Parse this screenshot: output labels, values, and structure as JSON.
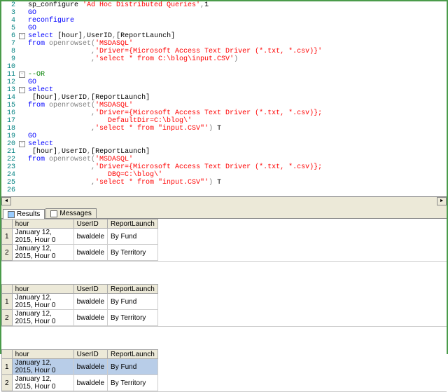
{
  "code_lines": [
    {
      "n": 2,
      "html": "<span class='kw-black'>sp_configure </span><span class='kw-red'>'Ad Hoc Distributed Queries'</span><span class='kw-gray'>,</span><span class='kw-black'>1</span>"
    },
    {
      "n": 3,
      "html": "<span class='kw-blue'>GO</span>"
    },
    {
      "n": 4,
      "html": "<span class='kw-blue'>reconfigure</span>"
    },
    {
      "n": 5,
      "html": "<span class='kw-blue'>GO</span>"
    },
    {
      "n": 6,
      "html": "<span class='kw-blue'>select</span><span class='kw-black'> [hour]</span><span class='kw-gray'>,</span><span class='kw-black'>UserID</span><span class='kw-gray'>,</span><span class='kw-black'>[ReportLaunch]</span>",
      "collapse": true
    },
    {
      "n": 7,
      "html": "<span class='kw-blue'>from</span><span class='kw-black'> </span><span class='kw-gray'>openrowset(</span><span class='kw-red'>'MSDASQL'</span>"
    },
    {
      "n": 8,
      "html": "<span class='kw-black'>               </span><span class='kw-gray'>,</span><span class='kw-red'>'Driver={Microsoft Access Text Driver (*.txt, *.csv)}'</span>"
    },
    {
      "n": 9,
      "html": "<span class='kw-black'>               </span><span class='kw-gray'>,</span><span class='kw-red'>'select * from C:\\blog\\input.CSV'</span><span class='kw-gray'>)</span>",
      "endcollapse": true
    },
    {
      "n": 10,
      "html": ""
    },
    {
      "n": 11,
      "html": "<span class='kw-green'>--OR</span>",
      "collapse": true
    },
    {
      "n": 12,
      "html": "<span class='kw-blue'>GO</span>"
    },
    {
      "n": 13,
      "html": "<span class='kw-blue'>select</span>",
      "collapse": true
    },
    {
      "n": 14,
      "html": "<span class='kw-black'> [hour]</span><span class='kw-gray'>,</span><span class='kw-black'>UserID</span><span class='kw-gray'>,</span><span class='kw-black'>[ReportLaunch]</span>"
    },
    {
      "n": 15,
      "html": "<span class='kw-blue'>from</span><span class='kw-black'> </span><span class='kw-gray'>openrowset(</span><span class='kw-red'>'MSDASQL'</span>"
    },
    {
      "n": 16,
      "html": "<span class='kw-black'>               </span><span class='kw-gray'>,</span><span class='kw-red'>'Driver={Microsoft Access Text Driver (*.txt, *.csv)};</span>"
    },
    {
      "n": 17,
      "html": "<span class='kw-red'>                   DefaultDir=C:\\blog\\'</span>"
    },
    {
      "n": 18,
      "html": "<span class='kw-black'>               </span><span class='kw-gray'>,</span><span class='kw-red'>'select * from \"input.CSV\"'</span><span class='kw-gray'>)</span><span class='kw-black'> T</span>"
    },
    {
      "n": 19,
      "html": "<span class='kw-blue'>GO</span>"
    },
    {
      "n": 20,
      "html": "<span class='kw-blue'>select</span>",
      "collapse": true
    },
    {
      "n": 21,
      "html": "<span class='kw-black'> [hour]</span><span class='kw-gray'>,</span><span class='kw-black'>UserID</span><span class='kw-gray'>,</span><span class='kw-black'>[ReportLaunch]</span>"
    },
    {
      "n": 22,
      "html": "<span class='kw-blue'>from</span><span class='kw-black'> </span><span class='kw-gray'>openrowset(</span><span class='kw-red'>'MSDASQL'</span>"
    },
    {
      "n": 23,
      "html": "<span class='kw-black'>               </span><span class='kw-gray'>,</span><span class='kw-red'>'Driver={Microsoft Access Text Driver (*.txt, *.csv)};</span>"
    },
    {
      "n": 24,
      "html": "<span class='kw-red'>                   DBQ=C:\\blog\\'</span>"
    },
    {
      "n": 25,
      "html": "<span class='kw-black'>               </span><span class='kw-gray'>,</span><span class='kw-red'>'select * from \"input.CSV\"'</span><span class='kw-gray'>)</span><span class='kw-black'> T</span>"
    },
    {
      "n": 26,
      "html": ""
    }
  ],
  "tabs": {
    "results_label": "Results",
    "messages_label": "Messages"
  },
  "grid": {
    "columns": [
      "hour",
      "UserID",
      "ReportLaunch"
    ],
    "rows": [
      {
        "row": 1,
        "hour": "January 12, 2015, Hour 0",
        "UserID": "bwaldele",
        "ReportLaunch": "By Fund"
      },
      {
        "row": 2,
        "hour": "January 12, 2015, Hour 0",
        "UserID": "bwaldele",
        "ReportLaunch": "By Territory"
      }
    ]
  }
}
